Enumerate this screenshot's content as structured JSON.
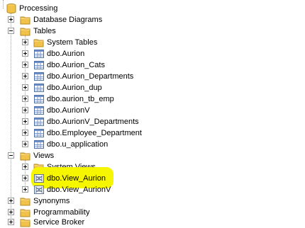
{
  "tree": {
    "database": "Processing",
    "database_diagrams": "Database Diagrams",
    "tables": {
      "label": "Tables",
      "system_tables": "System Tables",
      "items": [
        "dbo.Aurion",
        "dbo.Aurion_Cats",
        "dbo.Aurion_Departments",
        "dbo.Aurion_dup",
        "dbo.aurion_tb_emp",
        "dbo.AurionV",
        "dbo.AurionV_Departments",
        "dbo.Employee_Department",
        "dbo.u_application"
      ]
    },
    "views": {
      "label": "Views",
      "system_views": "System Views",
      "items": [
        "dbo.View_Aurion",
        "dbo.View_AurionV"
      ]
    },
    "synonyms": "Synonyms",
    "programmability": "Programmability",
    "service_broker": "Service Broker"
  },
  "colors": {
    "highlight": "#f6f600",
    "folder": "#f0c24a",
    "tree_line": "#a0a0a0"
  }
}
